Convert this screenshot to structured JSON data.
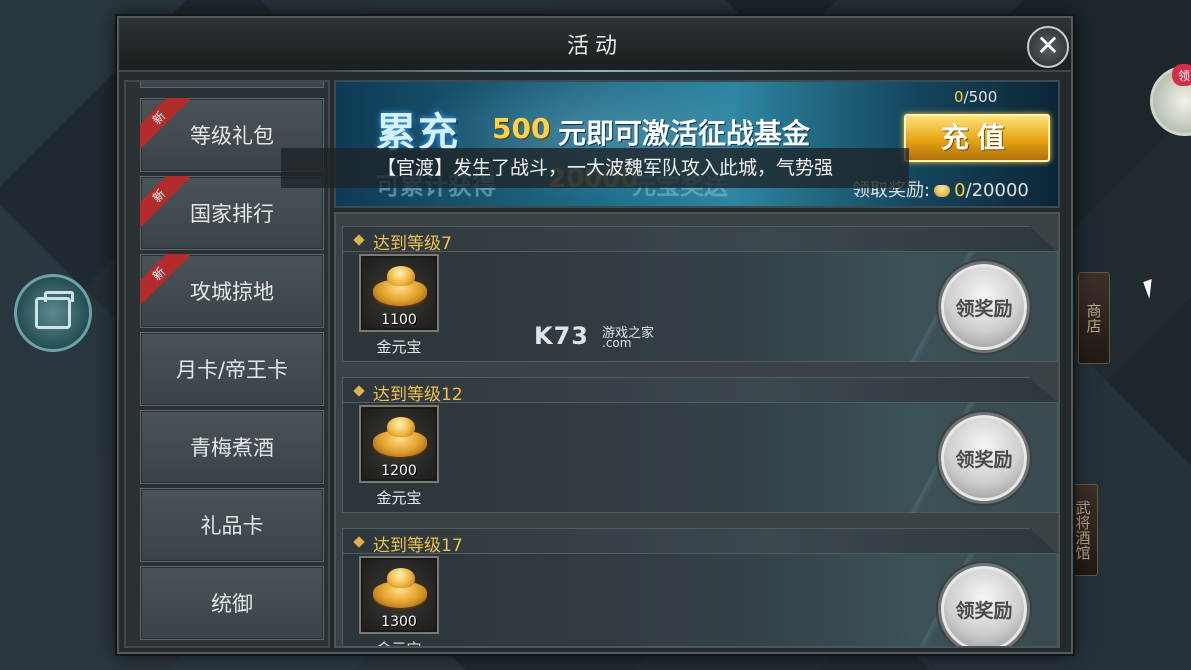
{
  "dialog": {
    "title": "活动",
    "close_symbol": "✕"
  },
  "tabs": [
    {
      "label": "等级礼包",
      "is_new": true
    },
    {
      "label": "国家排行",
      "is_new": true
    },
    {
      "label": "攻城掠地",
      "is_new": true
    },
    {
      "label": "月卡/帝王卡",
      "is_new": false
    },
    {
      "label": "青梅煮酒",
      "is_new": false
    },
    {
      "label": "礼品卡",
      "is_new": false
    },
    {
      "label": "统御",
      "is_new": false
    }
  ],
  "new_badge": "新",
  "banner": {
    "headline": "累充",
    "headline_amount": "500",
    "headline_rest": "元即可激活征战基金",
    "sub": "可累计获得",
    "sub_amount": "20000",
    "sub_rest": "元宝奖送",
    "progress_current": "0",
    "progress_total": "/500",
    "recharge_label": "充值",
    "reward_label": "领取奖励:",
    "reward_current": "0",
    "reward_total": "/20000"
  },
  "announcement": "【官渡】发生了战斗，一大波魏军队攻入此城，气势强",
  "rewards": [
    {
      "title": "达到等级7",
      "item_name": "金元宝",
      "qty": "1100",
      "claim_label": "领奖励"
    },
    {
      "title": "达到等级12",
      "item_name": "金元宝",
      "qty": "1200",
      "claim_label": "领奖励"
    },
    {
      "title": "达到等级17",
      "item_name": "金元宝",
      "qty": "1300",
      "claim_label": "领奖励"
    }
  ],
  "watermark": {
    "brand": "K73",
    "site": "游戏之家",
    "domain": ".com"
  },
  "background": {
    "right_badge": "领",
    "shop_label": "商店",
    "tavern_label": "武将酒馆"
  },
  "colors": {
    "gold": "#f2c04a",
    "accent_blue": "#2e86a2",
    "new_red": "#b32b2b"
  }
}
